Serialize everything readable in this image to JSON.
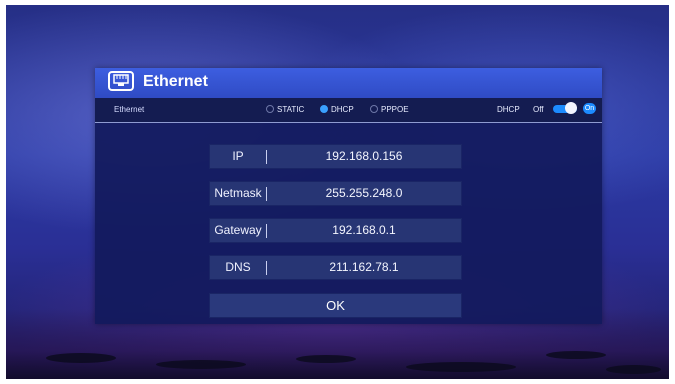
{
  "dialog": {
    "title": "Ethernet",
    "icon": "ethernet-port-icon"
  },
  "options": {
    "label": "Ethernet",
    "modes": [
      {
        "label": "STATIC",
        "selected": false
      },
      {
        "label": "DHCP",
        "selected": true
      },
      {
        "label": "PPPOE",
        "selected": false
      }
    ],
    "dhcp_toggle": {
      "label": "DHCP",
      "off_label": "Off",
      "on_label": "On",
      "state": "on"
    }
  },
  "fields": [
    {
      "label": "IP",
      "value": "192.168.0.156"
    },
    {
      "label": "Netmask",
      "value": "255.255.248.0"
    },
    {
      "label": "Gateway",
      "value": "192.168.0.1"
    },
    {
      "label": "DNS",
      "value": "211.162.78.1"
    }
  ],
  "ok_button": {
    "label": "OK"
  },
  "colors": {
    "accent": "#1c8bff",
    "titlebar": "#3d5ee0",
    "panel": "#121a5c"
  }
}
